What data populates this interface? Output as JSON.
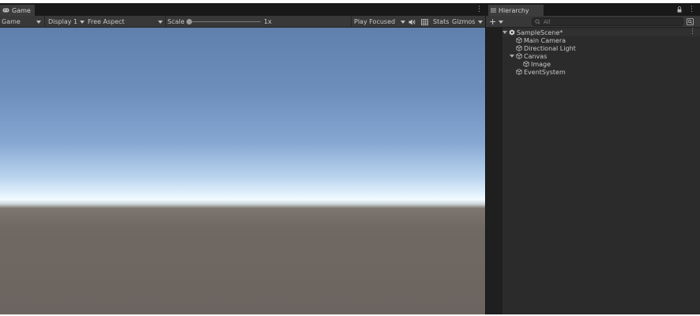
{
  "game_panel": {
    "tab_label": "Game",
    "toolbar": {
      "mode": "Game",
      "display": "Display 1",
      "aspect": "Free Aspect",
      "scale_label": "Scale",
      "scale_value": "1x",
      "play_mode": "Play Focused",
      "stats_label": "Stats",
      "gizmos_label": "Gizmos"
    },
    "icons": [
      "gamepad-icon",
      "speaker-icon",
      "grid-icon",
      "more-icon"
    ]
  },
  "hierarchy_panel": {
    "tab_label": "Hierarchy",
    "search_placeholder": "All",
    "scene": {
      "name": "SampleScene*"
    },
    "items": [
      {
        "label": "Main Camera",
        "depth": 1,
        "expandable": false
      },
      {
        "label": "Directional Light",
        "depth": 1,
        "expandable": false
      },
      {
        "label": "Canvas",
        "depth": 1,
        "expandable": true
      },
      {
        "label": "Image",
        "depth": 2,
        "expandable": false
      },
      {
        "label": "EventSystem",
        "depth": 1,
        "expandable": false
      }
    ],
    "icons": [
      "list-icon",
      "add-icon",
      "lock-icon",
      "search-icon",
      "scene-icon",
      "cube-icon"
    ]
  },
  "colors": {
    "editor_background": "#191919",
    "toolbar": "#383838",
    "panel": "#2b2b2b",
    "text": "#c8c8c8",
    "sky_top": "#5f7fac",
    "horizon": "#f2fbff",
    "ground": "#6c645f"
  }
}
